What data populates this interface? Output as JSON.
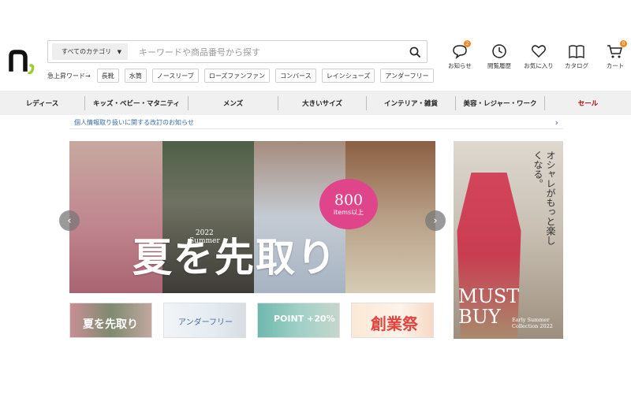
{
  "header": {
    "logo_alt": "n",
    "search": {
      "category_label": "すべてのカテゴリ",
      "placeholder": "キーワードや商品番号から探す"
    },
    "trend": {
      "label": "急上昇ワード→",
      "keywords": [
        "長靴",
        "水筒",
        "ノースリーブ",
        "ローズファンファン",
        "コンバース",
        "レインシューズ",
        "アンダーフリー"
      ]
    },
    "icons": [
      {
        "name": "notification-icon",
        "label": "お知らせ",
        "badge": "2"
      },
      {
        "name": "history-icon",
        "label": "閲覧履歴",
        "badge": ""
      },
      {
        "name": "heart-icon",
        "label": "お気に入り",
        "badge": ""
      },
      {
        "name": "catalog-icon",
        "label": "カタログ",
        "badge": ""
      },
      {
        "name": "cart-icon",
        "label": "カート",
        "badge": "0"
      }
    ]
  },
  "nav": {
    "categories": [
      "レディース",
      "キッズ・ベビー・マタニティ",
      "メンズ",
      "大きいサイズ",
      "インテリア・雑貨",
      "美容・レジャー・ワーク",
      "セール"
    ]
  },
  "notice": {
    "text": "個人情報取り扱いに関する改訂のお知らせ",
    "arrow": "›"
  },
  "hero": {
    "title": "夏を先取り",
    "year": "2022",
    "season": "Summer",
    "badge_number": "800",
    "badge_sub": "items以上",
    "prev": "‹",
    "next": "›"
  },
  "side_banner": {
    "vertical_text": "オシャレがもっと楽しくなる。",
    "must": "MUST",
    "buy": "BUY",
    "sub_line1": "Early Summer",
    "sub_line2": "Collection 2022"
  },
  "thumbnails": [
    {
      "text": "夏を先取り",
      "color": "#ffffff"
    },
    {
      "text": "アンダーフリー",
      "color": "#4a6b9a"
    },
    {
      "text": "POINT +20%",
      "color": "#ffffff"
    },
    {
      "text": "創業祭",
      "color": "#e2433c"
    }
  ],
  "colors": {
    "accent_orange": "#f08a24",
    "sale_red": "#c00000",
    "link_blue": "#3a6aa8",
    "badge_pink": "#e0448a"
  }
}
